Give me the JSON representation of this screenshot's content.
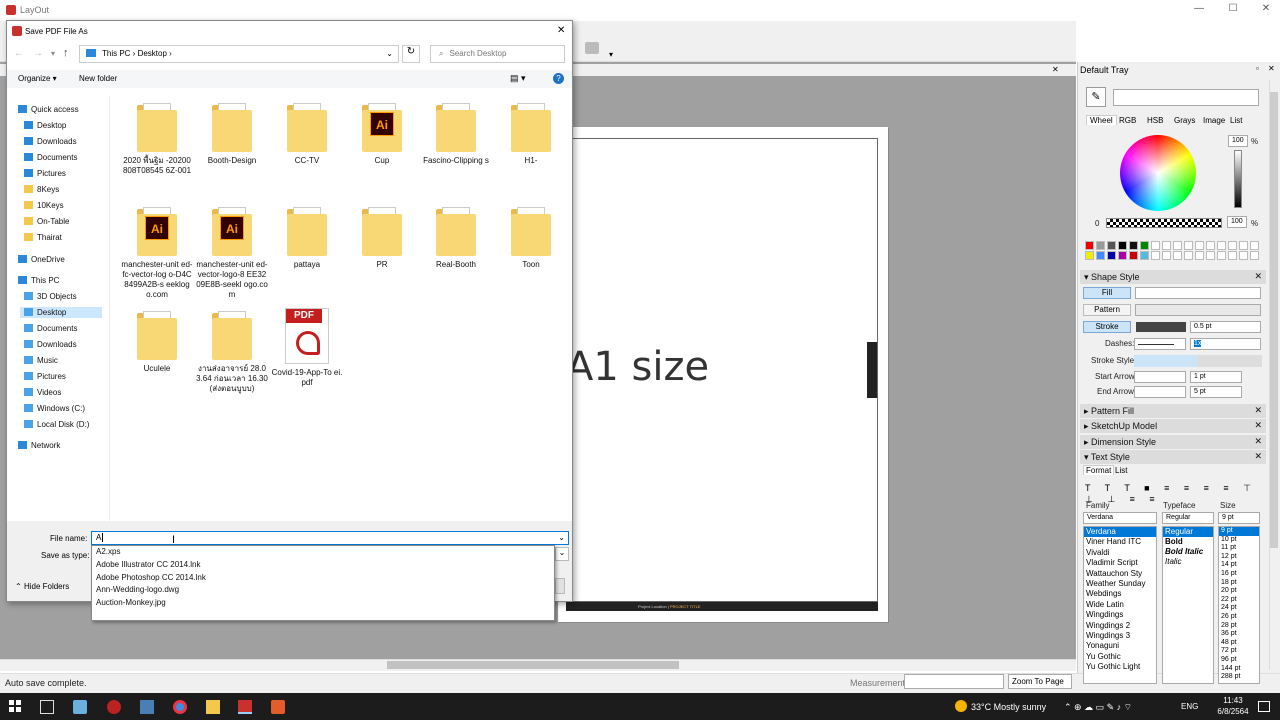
{
  "app": {
    "title": "LayOut"
  },
  "dialog": {
    "title": "Save PDF File As",
    "breadcrumb": [
      "This PC",
      "Desktop"
    ],
    "search_placeholder": "Search Desktop",
    "organize": "Organize ▾",
    "new_folder": "New folder",
    "nav": {
      "quick_access": "Quick access",
      "qa_items": [
        "Desktop",
        "Downloads",
        "Documents",
        "Pictures",
        "8Keys",
        "10Keys",
        "On-Table",
        "Thairat"
      ],
      "onedrive": "OneDrive",
      "this_pc": "This PC",
      "pc_items": [
        "3D Objects",
        "Desktop",
        "Documents",
        "Downloads",
        "Music",
        "Pictures",
        "Videos",
        "Windows (C:)",
        "Local Disk (D:)"
      ],
      "network": "Network"
    },
    "files": [
      {
        "name": "2020 พื้นฐิม -20200808T08545 6Z-001",
        "kind": "folder"
      },
      {
        "name": "Booth-Design",
        "kind": "folder"
      },
      {
        "name": "CC-TV",
        "kind": "folder"
      },
      {
        "name": "Cup",
        "kind": "ai-folder"
      },
      {
        "name": "Fascino-Clipping s",
        "kind": "folder"
      },
      {
        "name": "H1-",
        "kind": "folder"
      },
      {
        "name": "manchester-unit ed-fc-vector-log o-D4C8499A2B-s eeklogo.com",
        "kind": "ai-folder"
      },
      {
        "name": "manchester-unit ed-vector-logo-8 EE3209E8B-seekl ogo.com",
        "kind": "ai-folder"
      },
      {
        "name": "pattaya",
        "kind": "folder"
      },
      {
        "name": "PR",
        "kind": "folder"
      },
      {
        "name": "Real-Booth",
        "kind": "folder"
      },
      {
        "name": "Toon",
        "kind": "folder"
      },
      {
        "name": "Uculele",
        "kind": "folder"
      },
      {
        "name": "งานส่งอาจารย์ 28.03.64 ก่อนเวลา 16.30 (ส่งตอนบูบบ)",
        "kind": "folder"
      },
      {
        "name": "Covid-19-App-To ei.pdf",
        "kind": "pdf"
      }
    ],
    "file_name_label": "File name:",
    "file_name_value": "A",
    "save_as_type_label": "Save as type:",
    "hide_folders": "Hide Folders",
    "autocomplete": [
      "A2.xps",
      "Adobe Illustrator CC 2014.lnk",
      "Adobe Photoshop CC 2014.lnk",
      "Ann-Wedding-logo.dwg",
      "Auction-Monkey.jpg"
    ]
  },
  "canvas": {
    "page_text": "A1 size",
    "footer_left": "Project Location",
    "footer_right": "PROJECT TITLE"
  },
  "status": {
    "text": "Auto save complete.",
    "measurements_label": "Measurements",
    "zoom": "Zoom To Page"
  },
  "tray": {
    "title": "Default Tray",
    "color_tabs": [
      "Wheel",
      "RGB",
      "HSB",
      "Grays",
      "Image",
      "List"
    ],
    "opacity_top": "100",
    "opacity_bottom": "100",
    "pct": "%",
    "zero": "0",
    "shape_style": {
      "title": "Shape Style",
      "fill": "Fill",
      "pattern": "Pattern",
      "stroke": "Stroke",
      "stroke_width": "0.5 pt",
      "dashes": "Dashes:",
      "dash_scale": "1x",
      "stroke_style": "Stroke Style:",
      "start_arrow": "Start Arrow:",
      "start_size": "1 pt",
      "end_arrow": "End Arrow:",
      "end_size": "5 pt"
    },
    "collapsed": [
      "Pattern Fill",
      "SketchUp Model",
      "Dimension Style"
    ],
    "text_style": {
      "title": "Text Style",
      "tabs": [
        "Format",
        "List"
      ],
      "family_label": "Family",
      "typeface_label": "Typeface",
      "size_label": "Size",
      "family_value": "Verdana",
      "typeface_value": "Regular",
      "size_value": "9 pt",
      "families": [
        "Verdana",
        "Viner Hand ITC",
        "Vivaldi",
        "Vladimir Script",
        "Wattauchon Sty",
        "Weather Sunday",
        "Webdings",
        "Wide Latin",
        "Wingdings",
        "Wingdings 2",
        "Wingdings 3",
        "Yonaguni",
        "Yu Gothic",
        "Yu Gothic Light"
      ],
      "typefaces": [
        "Regular",
        "Bold",
        "Bold Italic",
        "Italic"
      ],
      "sizes": [
        "9 pt",
        "10 pt",
        "11 pt",
        "12 pt",
        "14 pt",
        "16 pt",
        "18 pt",
        "20 pt",
        "22 pt",
        "24 pt",
        "26 pt",
        "28 pt",
        "36 pt",
        "48 pt",
        "72 pt",
        "96 pt",
        "144 pt",
        "288 pt"
      ]
    }
  },
  "taskbar": {
    "weather": "33°C  Mostly sunny",
    "lang": "ENG",
    "time": "11:43",
    "date": "6/8/2564"
  },
  "colors": {
    "accent": "#0078d7",
    "selection": "#cce8ff",
    "folder": "#f8d775"
  }
}
